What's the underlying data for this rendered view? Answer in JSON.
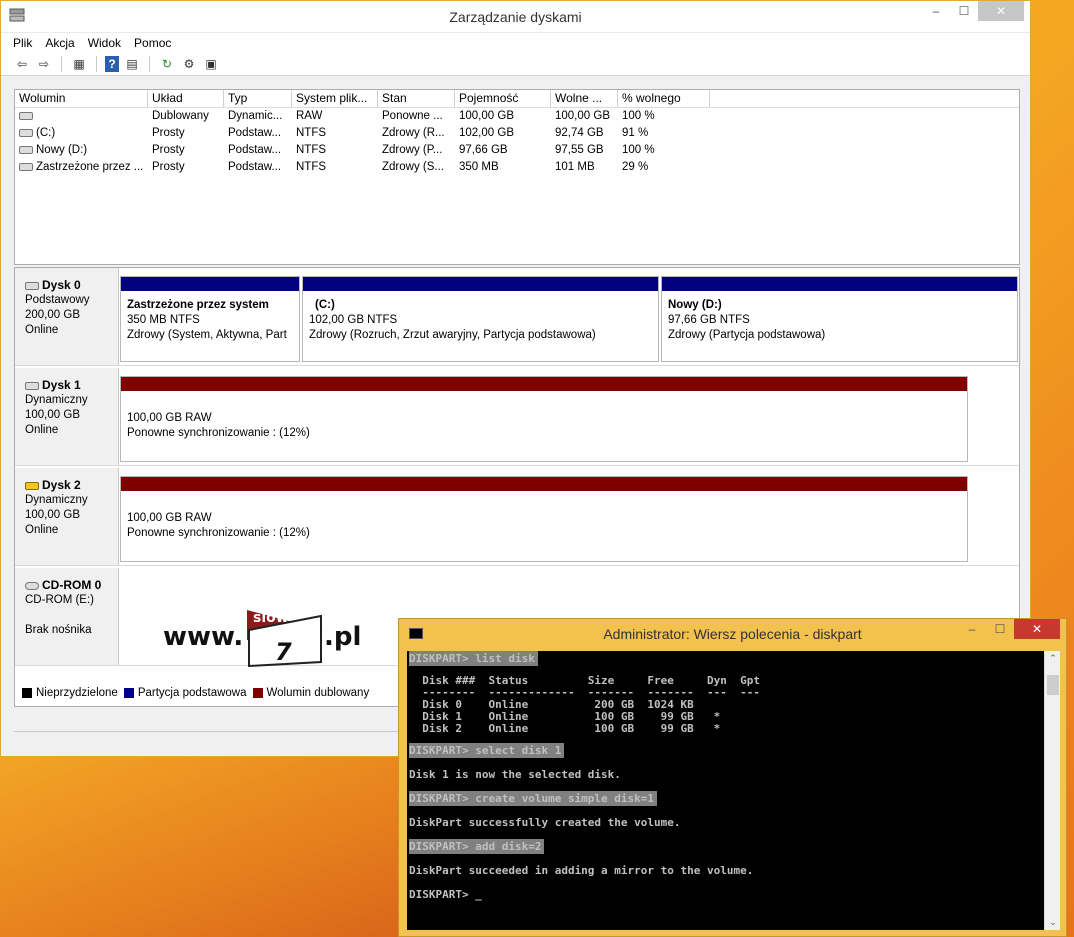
{
  "window": {
    "title": "Zarządzanie dyskami",
    "menu": [
      "Plik",
      "Akcja",
      "Widok",
      "Pomoc"
    ]
  },
  "volume_list": {
    "columns": [
      "Wolumin",
      "Układ",
      "Typ",
      "System plik...",
      "Stan",
      "Pojemność",
      "Wolne ...",
      "% wolnego"
    ],
    "rows": [
      [
        "",
        "Dublowany",
        "Dynamic...",
        "RAW",
        "Ponowne ...",
        "100,00 GB",
        "100,00 GB",
        "100 %"
      ],
      [
        "(C:)",
        "Prosty",
        "Podstaw...",
        "NTFS",
        "Zdrowy (R...",
        "102,00 GB",
        "92,74 GB",
        "91 %"
      ],
      [
        "Nowy (D:)",
        "Prosty",
        "Podstaw...",
        "NTFS",
        "Zdrowy (P...",
        "97,66 GB",
        "97,55 GB",
        "100 %"
      ],
      [
        "Zastrzeżone przez ...",
        "Prosty",
        "Podstaw...",
        "NTFS",
        "Zdrowy (S...",
        "350 MB",
        "101 MB",
        "29 %"
      ]
    ]
  },
  "disks": [
    {
      "name": "Dysk 0",
      "type": "Podstawowy",
      "size": "200,00 GB",
      "state": "Online",
      "partitions": [
        {
          "title": "Zastrzeżone przez system",
          "fs": "350 MB NTFS",
          "status": "Zdrowy (System, Aktywna, Part"
        },
        {
          "title": "(C:)",
          "fs": "102,00 GB NTFS",
          "status": "Zdrowy (Rozruch, Zrzut awaryjny, Partycja podstawowa)"
        },
        {
          "title": "Nowy  (D:)",
          "fs": "97,66 GB NTFS",
          "status": "Zdrowy (Partycja podstawowa)"
        }
      ]
    },
    {
      "name": "Dysk 1",
      "type": "Dynamiczny",
      "size": "100,00 GB",
      "state": "Online",
      "partitions": [
        {
          "fs": "100,00 GB RAW",
          "status": "Ponowne synchronizowanie : (12%)"
        }
      ]
    },
    {
      "name": "Dysk 2",
      "type": "Dynamiczny",
      "size": "100,00 GB",
      "state": "Online",
      "partitions": [
        {
          "fs": "100,00 GB RAW",
          "status": "Ponowne synchronizowanie : (12%)"
        }
      ]
    },
    {
      "name": "CD-ROM 0",
      "type": "CD-ROM (E:)",
      "state": "Brak nośnika"
    }
  ],
  "legend": [
    "Nieprzydzielone",
    "Partycja podstawowa",
    "Wolumin dublowany"
  ],
  "colors": {
    "unallocated": "#000000",
    "primary": "#000080",
    "mirrored": "#800000"
  },
  "logo": {
    "www": "www.",
    "slow": "slow",
    "seven": "7",
    "pl": ".pl"
  },
  "console": {
    "title": "Administrator: Wiersz polecenia - diskpart",
    "lines": {
      "cmd1": "DISKPART> list disk",
      "hdr": "  Disk ###  Status         Size     Free     Dyn  Gpt",
      "sep": "  --------  -------------  -------  -------  ---  ---",
      "d0": "  Disk 0    Online          200 GB  1024 KB",
      "d1": "  Disk 1    Online          100 GB    99 GB   *",
      "d2": "  Disk 2    Online          100 GB    99 GB   *",
      "cmd2": "DISKPART> select disk 1",
      "out2": "Disk 1 is now the selected disk.",
      "cmd3": "DISKPART> create volume simple disk=1",
      "out3": "DiskPart successfully created the volume.",
      "cmd4": "DISKPART> add disk=2",
      "out4": "DiskPart succeeded in adding a mirror to the volume.",
      "prompt": "DISKPART> _"
    }
  }
}
